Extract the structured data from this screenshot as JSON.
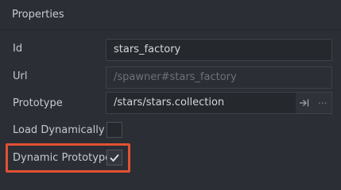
{
  "panel": {
    "title": "Properties"
  },
  "properties": {
    "id": {
      "label": "Id",
      "value": "stars_factory"
    },
    "url": {
      "label": "Url",
      "value": "/spawner#stars_factory"
    },
    "prototype": {
      "label": "Prototype",
      "value": "/stars/stars.collection",
      "goto_icon": "go-to-resource-icon",
      "browse_label": "..."
    },
    "load_dynamically": {
      "label": "Load Dynamically",
      "checked": false
    },
    "dynamic_prototype": {
      "label": "Dynamic Prototype",
      "checked": true
    }
  },
  "colors": {
    "background": "#2b2e34",
    "field_background": "#25282d",
    "field_border": "#3e4249",
    "text": "#c6c9cf",
    "readonly_text": "#6d7178",
    "highlight": "#e25132"
  }
}
